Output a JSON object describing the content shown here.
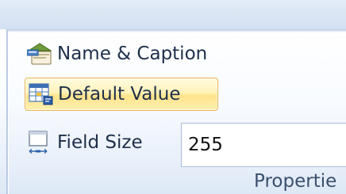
{
  "ribbon": {
    "name_caption_label": "Name & Caption",
    "default_value_label": "Default Value",
    "field_size_label": "Field Size",
    "field_size_value": "255",
    "group_label": "Propertie"
  },
  "icons": {
    "name_caption": "name-caption-icon",
    "default_value": "default-value-icon",
    "field_size": "field-size-icon"
  },
  "colors": {
    "hover_fill": "#ffe38a",
    "hover_border": "#e8b556",
    "text": "#1e2f4a",
    "group_label": "#3b4f6d"
  }
}
